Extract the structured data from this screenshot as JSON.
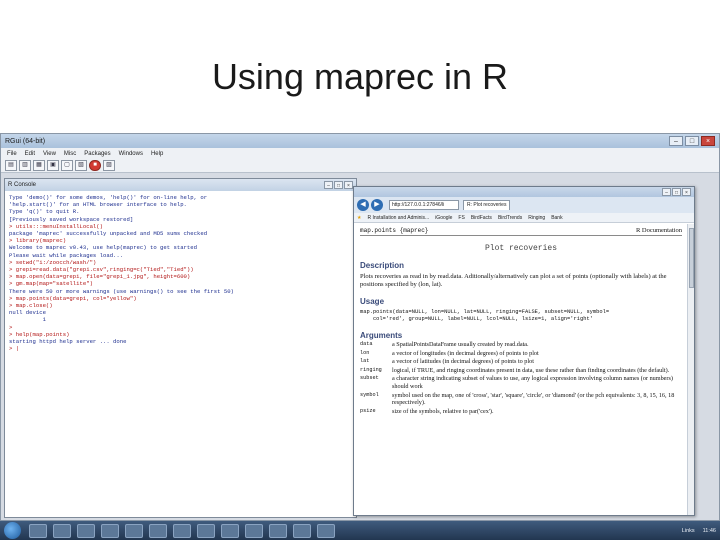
{
  "slide": {
    "title": "Using maprec in R"
  },
  "rgui": {
    "title": "RGui (64-bit)",
    "menu": [
      "File",
      "Edit",
      "View",
      "Misc",
      "Packages",
      "Windows",
      "Help"
    ],
    "win_controls": [
      "–",
      "□",
      "×"
    ]
  },
  "console": {
    "title": "R Console",
    "lines": [
      {
        "kind": "out",
        "text": "Type 'demo()' for some demos, 'help()' for on-line help, or"
      },
      {
        "kind": "out",
        "text": "'help.start()' for an HTML browser interface to help."
      },
      {
        "kind": "out",
        "text": "Type 'q()' to quit R."
      },
      {
        "kind": "out",
        "text": ""
      },
      {
        "kind": "out",
        "text": "[Previously saved workspace restored]"
      },
      {
        "kind": "out",
        "text": ""
      },
      {
        "kind": "cmd",
        "text": "> utils:::menuInstallLocal()"
      },
      {
        "kind": "out",
        "text": "package 'maprec' successfully unpacked and MD5 sums checked"
      },
      {
        "kind": "cmd",
        "text": "> library(maprec)"
      },
      {
        "kind": "out",
        "text": "Welcome to maprec v0.43, use help(maprec) to get started"
      },
      {
        "kind": "out",
        "text": "Please wait while packages load..."
      },
      {
        "kind": "cmd",
        "text": "> setwd(\"i:/zoocch/wash/\")"
      },
      {
        "kind": "cmd",
        "text": "> grepi=read.data(\"grepi.csv\",ringing=c(\"Tied\",\"Tied\"))"
      },
      {
        "kind": "cmd",
        "text": "> map.open(data=grepi, file=\"grepi_1.jpg\", height=600)"
      },
      {
        "kind": "cmd",
        "text": "> gm.map(map=\"satellite\")"
      },
      {
        "kind": "out",
        "text": "There were 50 or more warnings (use warnings() to see the first 50)"
      },
      {
        "kind": "cmd",
        "text": "> map.points(data=grepi, col=\"yellow\")"
      },
      {
        "kind": "cmd",
        "text": "> map.close()"
      },
      {
        "kind": "out",
        "text": "null device"
      },
      {
        "kind": "out",
        "text": "          1"
      },
      {
        "kind": "cmd",
        "text": ">"
      },
      {
        "kind": "cmd",
        "text": "> help(map.points)"
      },
      {
        "kind": "out",
        "text": "starting httpd help server ... done"
      },
      {
        "kind": "cursor",
        "text": "> |"
      }
    ]
  },
  "browser": {
    "address": "http://127.0.0.1:27846/li",
    "tab": "R: Plot recoveries",
    "favorites": [
      "R Installation and Adminis...",
      "iGoogle",
      "FS",
      "BirdFacts",
      "BirdTrends",
      "Ringing",
      "Bank"
    ],
    "help": {
      "topic": "map.points {maprec}",
      "doc_label": "R Documentation",
      "title": "Plot recoveries",
      "description_heading": "Description",
      "description": "Plots recoveries as read in by read.data. Aditionally/alternatively can plot a set of points (optionally with labels) at the positions specified by (lon, lat).",
      "usage_heading": "Usage",
      "usage": "map.points(data=NULL, lon=NULL, lat=NULL, ringing=FALSE, subset=NULL, symbol=\n    col='red', group=NULL, label=NULL, lcol=NULL, lsize=1, align='right'",
      "arguments_heading": "Arguments",
      "arguments": [
        {
          "name": "data",
          "desc": "a SpatialPointsDataFrame usually created by read.data."
        },
        {
          "name": "lon",
          "desc": "a vector of longitudes (in decimal degrees) of points to plot"
        },
        {
          "name": "lat",
          "desc": "a vector of latitudes (in decimal degrees) of points to plot"
        },
        {
          "name": "ringing",
          "desc": "logical, if TRUE, and ringing coordinates present in data, use these rather than finding coordinates (the default)."
        },
        {
          "name": "subset",
          "desc": "a character string indicating subset of values to use, any logical expression involving column names (or numbers) should work"
        },
        {
          "name": "symbol",
          "desc": "symbol used on the map, one of 'cross', 'star', 'square', 'circle', or 'diamond' (or the pch equivalents: 3, 8, 15, 16, 18 respectively)."
        },
        {
          "name": "psize",
          "desc": "size of the symbols, relative to par('cex')."
        }
      ]
    }
  },
  "taskbar": {
    "links": "Links",
    "clock": "11:46"
  }
}
